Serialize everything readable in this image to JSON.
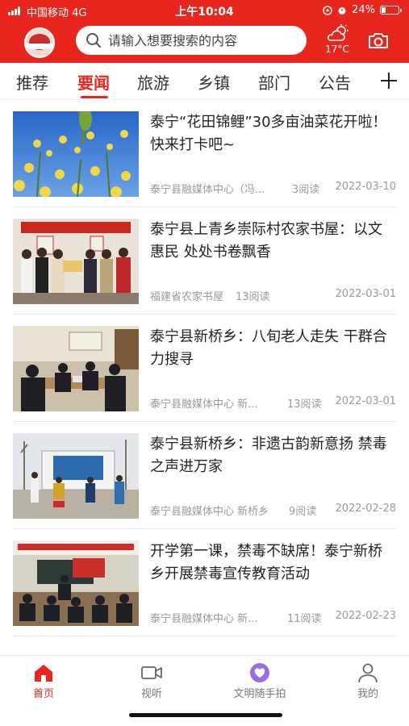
{
  "status_bar": {
    "carrier": "中国移动",
    "network": "4G",
    "time": "上午10:04",
    "battery_text": "24%",
    "battery_level": 0.24
  },
  "header": {
    "logo_icon": "tainning-media-logo",
    "search_placeholder": "请输入想要搜索的内容",
    "weather_icon": "cloud-sun-icon",
    "temperature": "17°C",
    "camera_icon": "camera-icon",
    "accent_color": "#e8261d"
  },
  "tabs": [
    {
      "label": "推荐",
      "active": false
    },
    {
      "label": "要闻",
      "active": true
    },
    {
      "label": "旅游",
      "active": false
    },
    {
      "label": "乡镇",
      "active": false
    },
    {
      "label": "部门",
      "active": false
    },
    {
      "label": "公告",
      "active": false
    }
  ],
  "articles": [
    {
      "title": "泰宁“花田锦鲤”30多亩油菜花开啦！快来打卡吧~",
      "source": "泰宁县融媒体中心（冯...",
      "reads": "3阅读",
      "date": "2022-03-10",
      "thumb": "rapeseed-flowers-sky"
    },
    {
      "title": "泰宁县上青乡崇际村农家书屋：以文惠民 处处书卷飘香",
      "source": "福建省农家书屋",
      "reads": "13阅读",
      "date": "2022-03-01",
      "thumb": "award-ceremony-group"
    },
    {
      "title": "泰宁县新桥乡：八旬老人走失 干群合力搜寻",
      "source": "泰宁县融媒体中心 新...",
      "reads": "13阅读",
      "date": "2022-03-01",
      "thumb": "meeting-room"
    },
    {
      "title": "泰宁县新桥乡：非遗古韵新意扬 禁毒之声进万家",
      "source": "泰宁县融媒体中心 新桥乡",
      "reads": "9阅读",
      "date": "2022-02-28",
      "thumb": "outdoor-stage"
    },
    {
      "title": "开学第一课，禁毒不缺席！泰宁新桥乡开展禁毒宣传教育活动",
      "source": "泰宁县融媒体中心 新...",
      "reads": "11阅读",
      "date": "2022-02-23",
      "thumb": "classroom"
    }
  ],
  "bottom_nav": [
    {
      "label": "首页",
      "icon": "home-icon",
      "active": true
    },
    {
      "label": "视听",
      "icon": "video-camera-icon",
      "active": false
    },
    {
      "label": "文明随手拍",
      "icon": "heart-hand-icon",
      "active": false
    },
    {
      "label": "我的",
      "icon": "user-icon",
      "active": false
    }
  ]
}
